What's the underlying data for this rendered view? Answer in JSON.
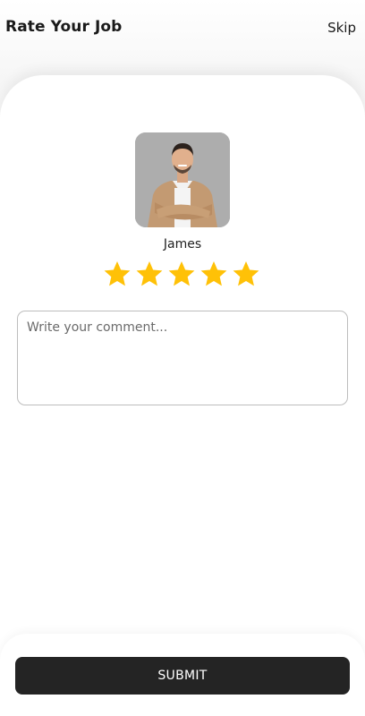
{
  "header": {
    "title": "Rate Your Job",
    "skip_label": "Skip"
  },
  "worker": {
    "name": "James",
    "avatar_icon": "person-photo"
  },
  "rating": {
    "value": 5,
    "max": 5,
    "star_color": "#FFC107"
  },
  "comment": {
    "placeholder": "Write your comment...",
    "value": ""
  },
  "footer": {
    "submit_label": "SUBMIT"
  },
  "colors": {
    "button_bg": "#242424",
    "button_text": "#ffffff"
  }
}
